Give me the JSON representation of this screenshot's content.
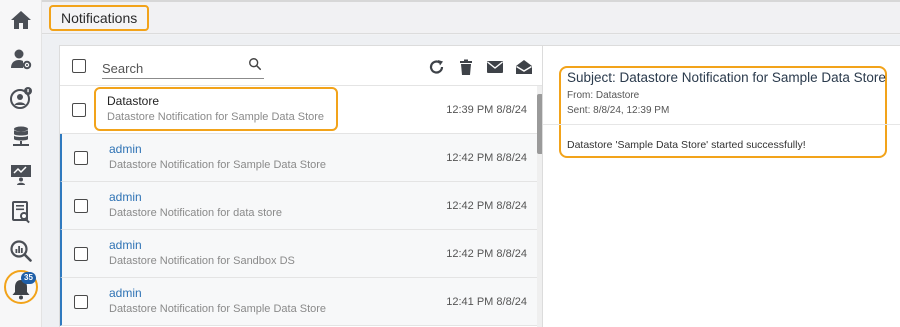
{
  "header": {
    "title": "Notifications"
  },
  "sidebar": {
    "items": [
      {
        "icon": "home-icon"
      },
      {
        "icon": "user-settings-icon"
      },
      {
        "icon": "user-info-icon"
      },
      {
        "icon": "database-icon"
      },
      {
        "icon": "dashboard-user-icon"
      },
      {
        "icon": "report-search-icon"
      },
      {
        "icon": "search-analytics-icon"
      },
      {
        "icon": "bell-icon",
        "badge": "35"
      }
    ]
  },
  "toolbar": {
    "search_placeholder": "Search",
    "actions": [
      "refresh-icon",
      "delete-icon",
      "mark-unread-icon",
      "mark-read-icon"
    ]
  },
  "notifications": [
    {
      "sender": "Datastore",
      "subject": "Datastore Notification for Sample Data Store",
      "time": "12:39 PM 8/8/24",
      "selected": true
    },
    {
      "sender": "admin",
      "subject": "Datastore Notification for Sample Data Store",
      "time": "12:42 PM 8/8/24"
    },
    {
      "sender": "admin",
      "subject": "Datastore Notification for data store",
      "time": "12:42 PM 8/8/24"
    },
    {
      "sender": "admin",
      "subject": "Datastore Notification for Sandbox DS",
      "time": "12:42 PM 8/8/24"
    },
    {
      "sender": "admin",
      "subject": "Datastore Notification for Sample Data Store",
      "time": "12:41 PM 8/8/24"
    }
  ],
  "detail": {
    "subject": "Subject: Datastore Notification for Sample Data Store",
    "from": "From: Datastore",
    "sent": "Sent: 8/8/24, 12:39 PM",
    "body": "Datastore 'Sample Data Store' started successfully!"
  },
  "colors": {
    "highlight": "#f2a31a",
    "accent": "#2f73b5",
    "badge": "#1f5fa8"
  }
}
